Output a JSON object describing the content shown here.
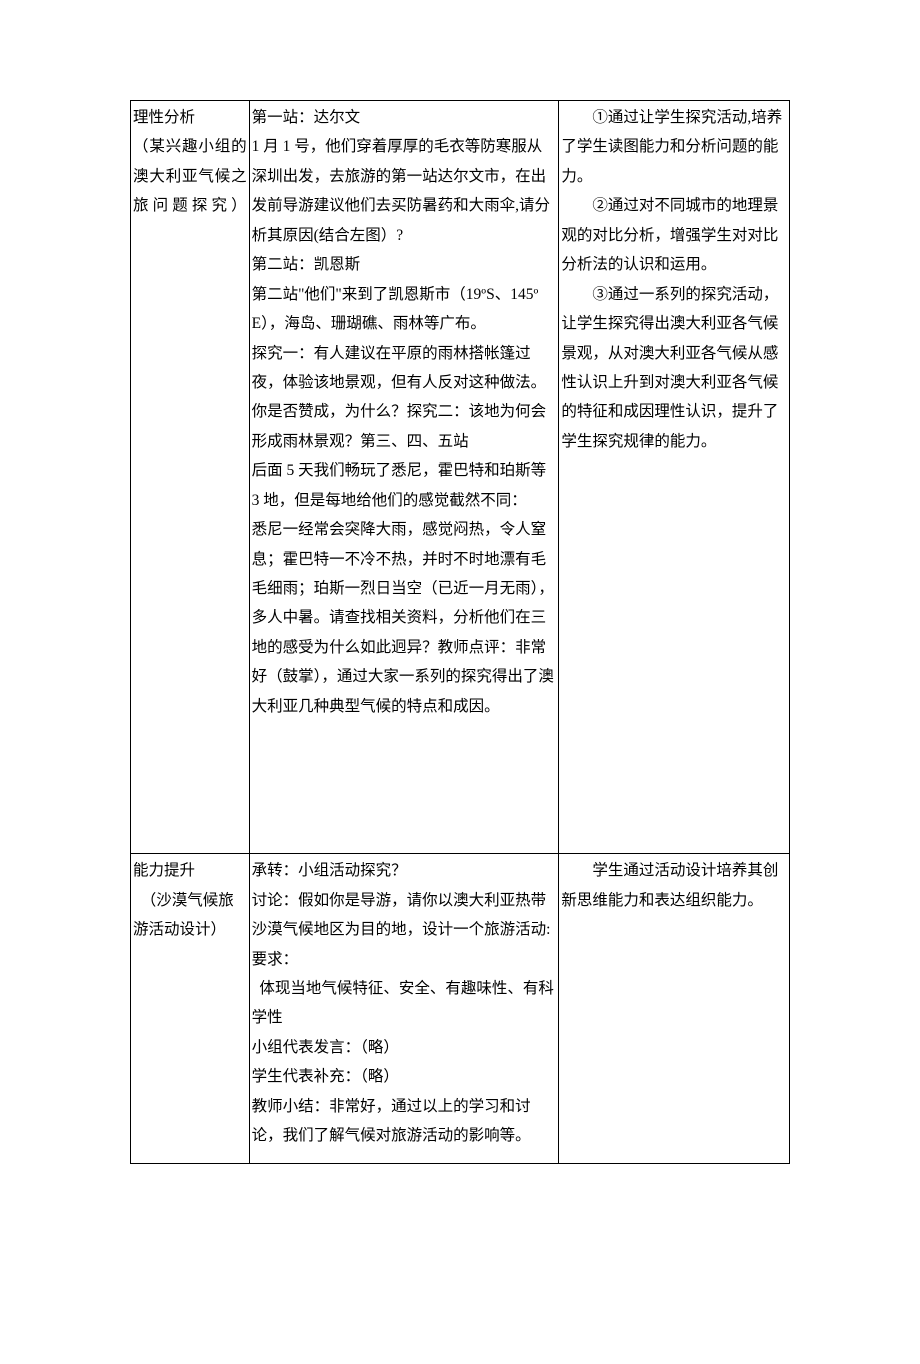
{
  "row1": {
    "col1_line1": "理性分析",
    "col1_line2": "（某兴趣小组的澳大利亚气候之旅问题探究）",
    "col2": "第一站：达尔文\n1 月 1 号，他们穿着厚厚的毛衣等防寒服从深圳出发，去旅游的第一站达尔文市，在出发前导游建议他们去买防暑药和大雨伞,请分析其原因(结合左图）?\n第二站：凯恩斯\n第二站\"他们\"来到了凯恩斯市（19ºS、145ºE），海岛、珊瑚礁、雨林等广布。\n探究一：有人建议在平原的雨林搭帐篷过夜，体验该地景观，但有人反对这种做法。你是否赞成，为什么？探究二：该地为何会形成雨林景观？第三、四、五站\n后面 5 天我们畅玩了悉尼，霍巴特和珀斯等 3 地，但是每地给他们的感觉截然不同：\n悉尼一经常会突降大雨，感觉闷热，令人窒息；霍巴特一不冷不热，并时不时地漂有毛毛细雨；珀斯一烈日当空（已近一月无雨），多人中暑。请查找相关资料，分析他们在三地的感受为什么如此迥异？教师点评：非常好（鼓掌），通过大家一系列的探究得出了澳大利亚几种典型气候的特点和成因。",
    "col3_p1": "①通过让学生探究活动,培养了学生读图能力和分析问题的能力。",
    "col3_p2": "②通过对不同城市的地理景观的对比分析，增强学生对对比分析法的认识和运用。",
    "col3_p3": "③通过一系列的探究活动，让学生探究得出澳大利亚各气候景观，从对澳大利亚各气候从感性认识上升到对澳大利亚各气候的特征和成因理性认识，提升了学生探究规律的能力。"
  },
  "row2": {
    "col1_line1": "能力提升",
    "col1_line2": "（沙漠气候旅游活动设计）",
    "col2_l1": "承转：小组活动探究？",
    "col2_l2": "讨论：假如你是导游，请你以澳大利亚热带沙漠气候地区为目的地，设计一个旅游活动:",
    "col2_l3": "要求：",
    "col2_l4": "  体现当地气候特征、安全、有趣味性、有科学性",
    "col2_l5": "小组代表发言：（略）",
    "col2_l6": "学生代表补充：（略）",
    "col2_l7": "教师小结：非常好，通过以上的学习和讨论，我们了解气候对旅游活动的影响等。",
    "col3": "学生通过活动设计培养其创新思维能力和表达组织能力。"
  }
}
